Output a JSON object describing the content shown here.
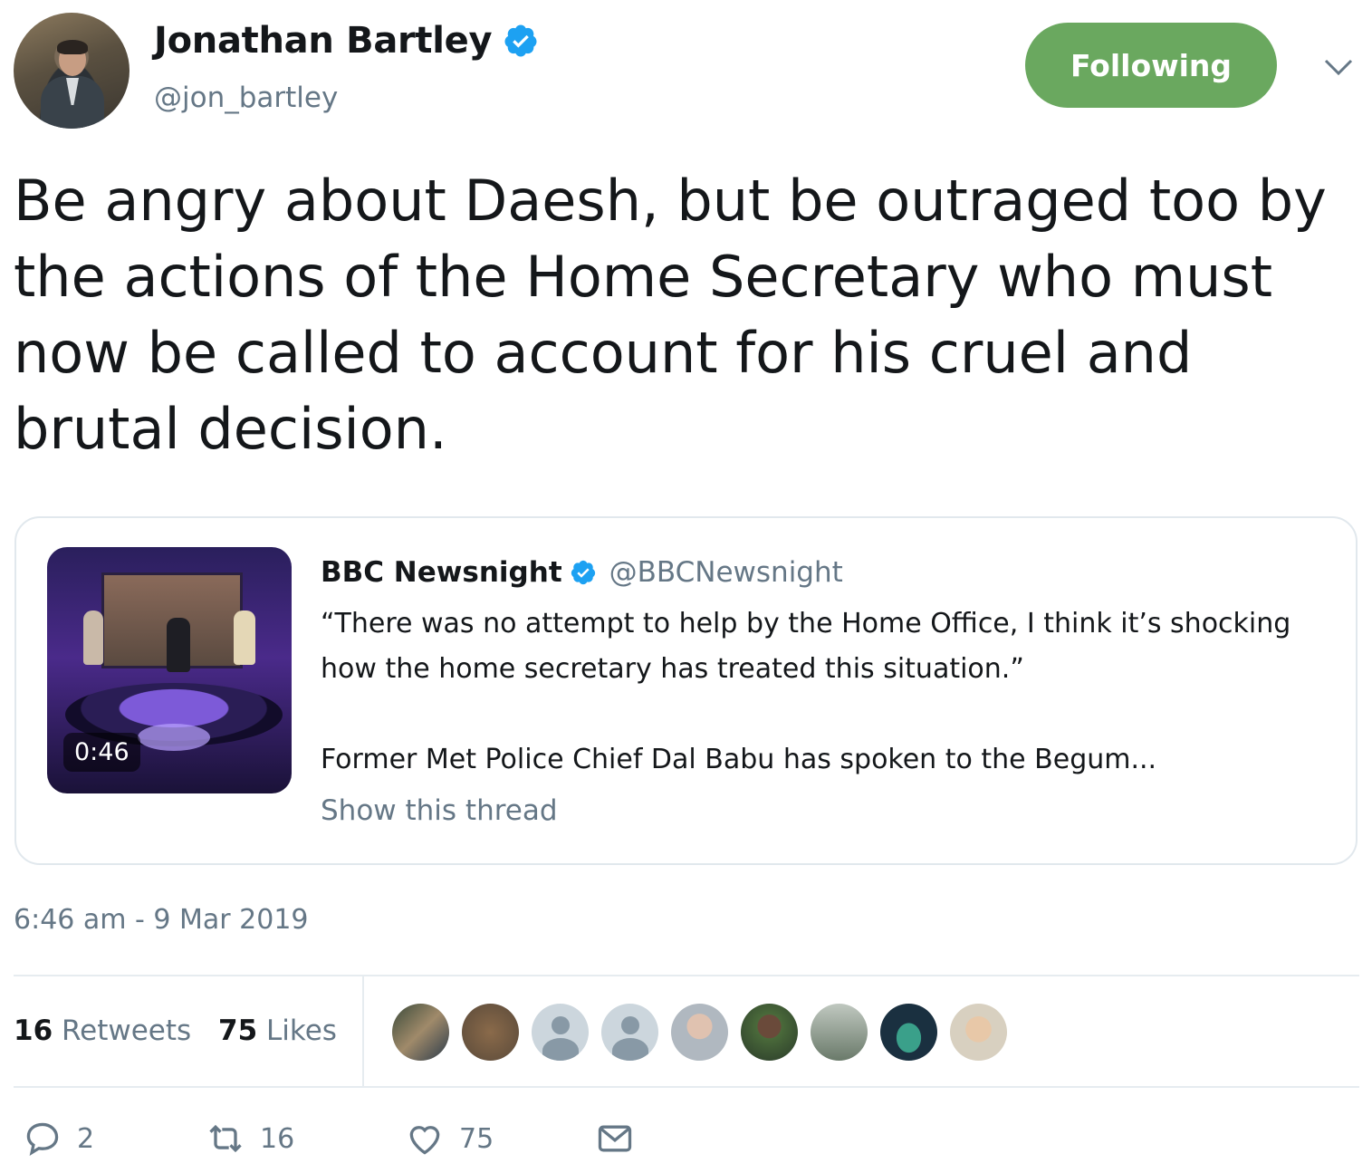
{
  "author": {
    "display_name": "Jonathan Bartley",
    "handle": "@jon_bartley",
    "verified": true,
    "follow_button_label": "Following"
  },
  "tweet": {
    "text": "Be angry about Daesh, but be outraged too by the actions of the Home Secretary who must now be called to account for his cruel and brutal decision.",
    "timestamp": "6:46 am - 9 Mar 2019"
  },
  "quoted_tweet": {
    "display_name": "BBC Newsnight",
    "handle": "@BBCNewsnight",
    "verified": true,
    "video_duration": "0:46",
    "body_line1": "“There was no attempt to help by the Home Office, I think it’s shocking how the home secretary has treated this situation.”",
    "body_line2": "Former Met Police Chief Dal Babu has spoken to the Begum...",
    "show_thread_label": "Show this thread"
  },
  "stats": {
    "retweets_count": "16",
    "retweets_label": "Retweets",
    "likes_count": "75",
    "likes_label": "Likes"
  },
  "actions": {
    "reply_count": "2",
    "retweet_count": "16",
    "like_count": "75"
  },
  "colors": {
    "follow_button": "#6aa85f",
    "verified_badge": "#1da1f2",
    "secondary_text": "#657786"
  }
}
